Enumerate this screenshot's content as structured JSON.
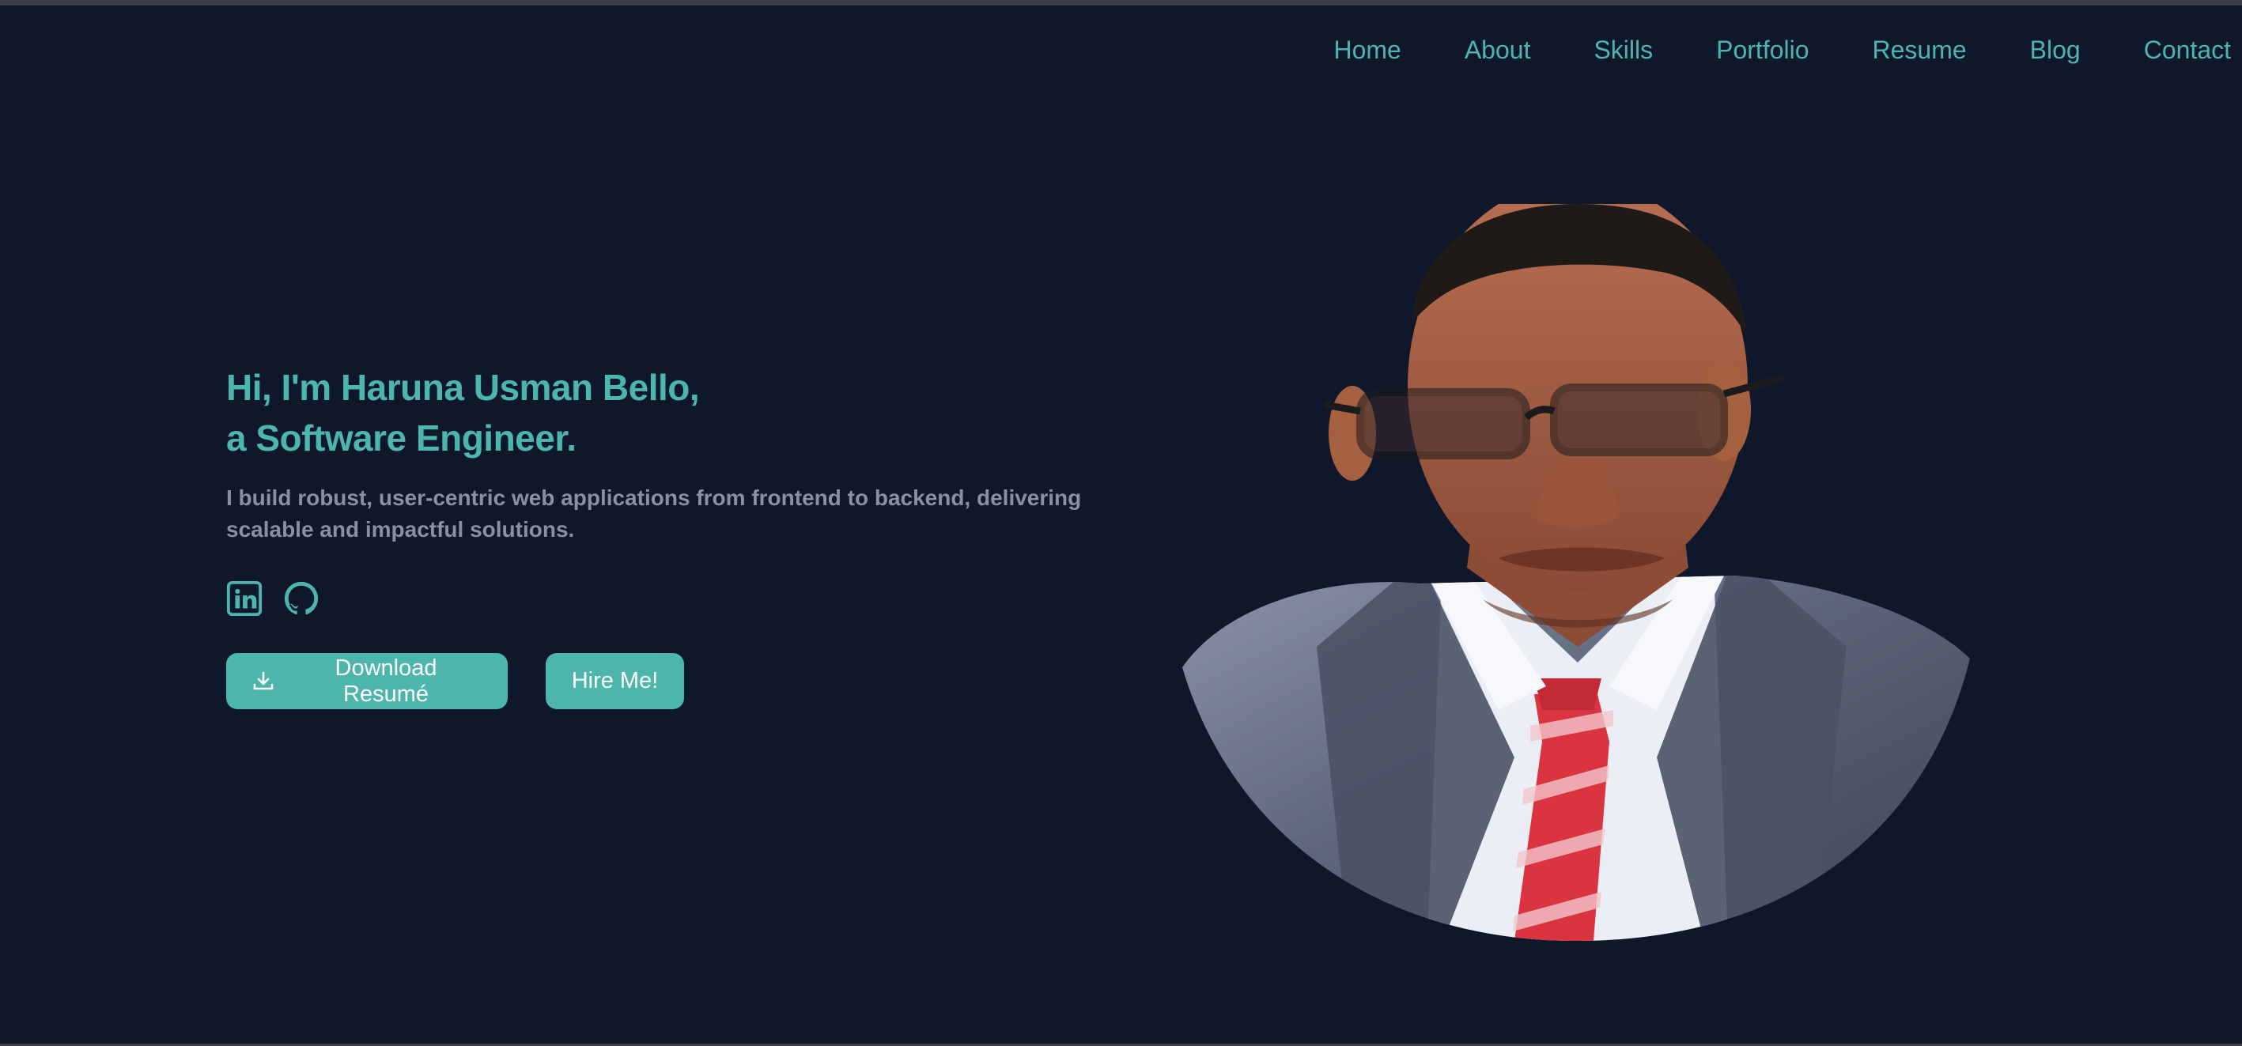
{
  "nav": {
    "items": [
      {
        "label": "Home"
      },
      {
        "label": "About"
      },
      {
        "label": "Skills"
      },
      {
        "label": "Portfolio"
      },
      {
        "label": "Resume"
      },
      {
        "label": "Blog"
      },
      {
        "label": "Contact"
      }
    ]
  },
  "hero": {
    "headline_line1": "Hi, I'm Haruna Usman Bello,",
    "headline_line2": "a Software Engineer.",
    "tagline": "I build robust, user-centric web applications from frontend to backend, delivering scalable and impactful solutions."
  },
  "socials": [
    {
      "icon": "linkedin-icon"
    },
    {
      "icon": "github-icon"
    }
  ],
  "buttons": {
    "download_label": "Download Resumé",
    "download_icon": "download-icon",
    "hire_label": "Hire Me!"
  },
  "colors": {
    "background": "#0f172a",
    "accent": "#4db6ac",
    "muted_text": "#8a919e",
    "button_text": "#ffffff"
  }
}
